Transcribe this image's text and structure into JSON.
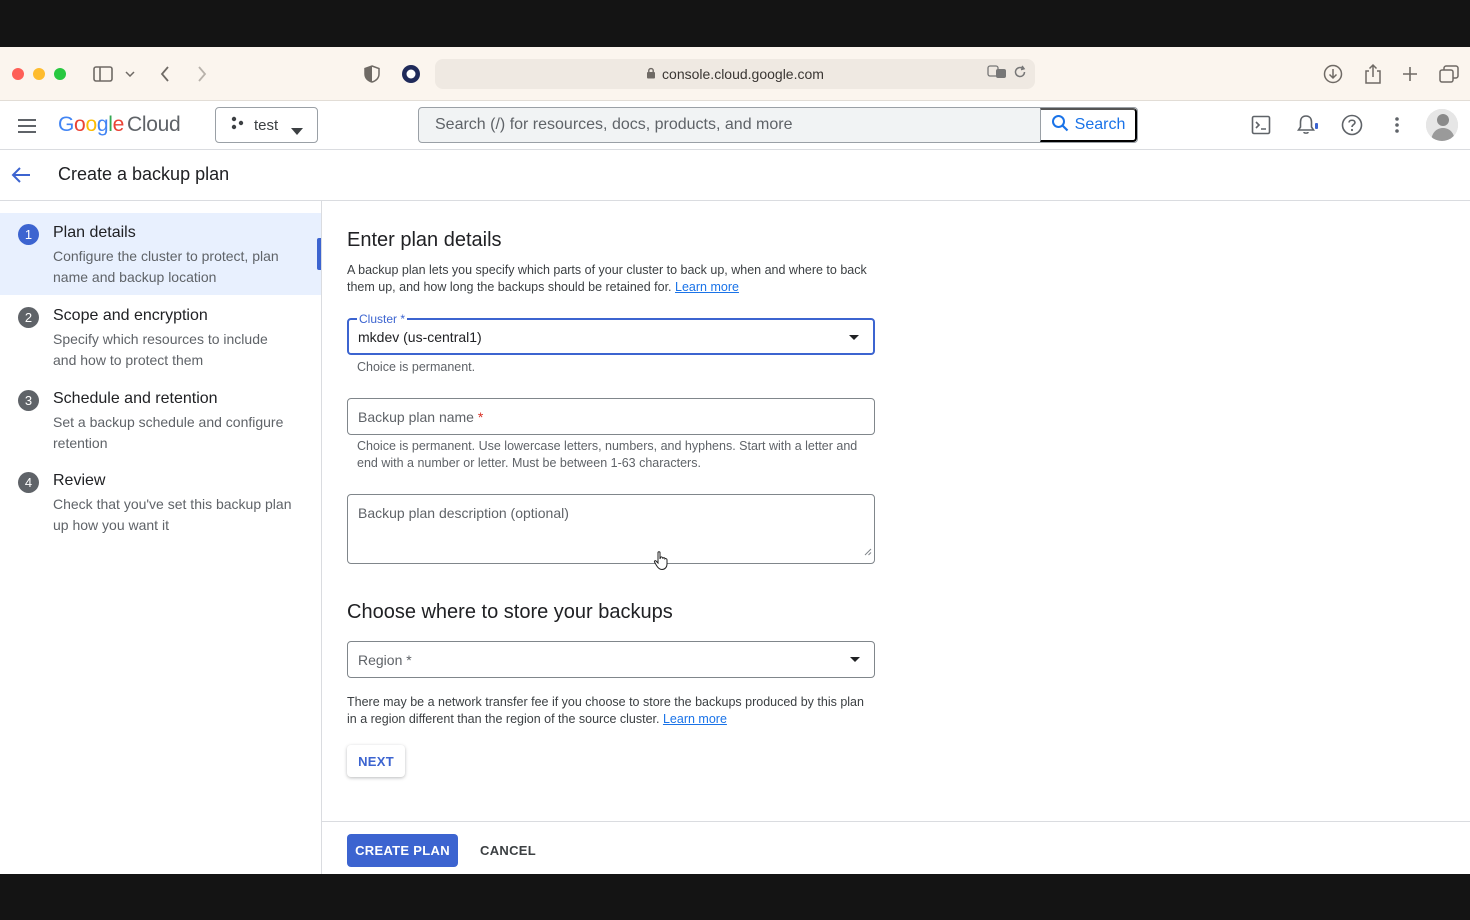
{
  "browser": {
    "url": "console.cloud.google.com"
  },
  "header": {
    "logo": {
      "g1": "G",
      "g2": "o",
      "g3": "o",
      "g4": "g",
      "g5": "l",
      "g6": "e",
      "cloud": "Cloud"
    },
    "project": "test",
    "search_placeholder": "Search (/) for resources, docs, products, and more",
    "search_button": "Search"
  },
  "page": {
    "title": "Create a backup plan"
  },
  "stepper": {
    "steps": [
      {
        "num": "1",
        "title": "Plan details",
        "desc": "Configure the cluster to protect, plan name and backup location"
      },
      {
        "num": "2",
        "title": "Scope and encryption",
        "desc": "Specify which resources to include and how to protect them"
      },
      {
        "num": "3",
        "title": "Schedule and retention",
        "desc": "Set a backup schedule and configure retention"
      },
      {
        "num": "4",
        "title": "Review",
        "desc": "Check that you've set this backup plan up how you want it"
      }
    ]
  },
  "form": {
    "heading": "Enter plan details",
    "intro": "A backup plan lets you specify which parts of your cluster to back up, when and where to back them up, and how long the backups should be retained for.",
    "learn_more": "Learn more",
    "cluster": {
      "label": "Cluster",
      "required_mark": "*",
      "value": "mkdev (us-central1)",
      "hint": "Choice is permanent."
    },
    "plan_name": {
      "label": "Backup plan name",
      "required_mark": "*",
      "hint": "Choice is permanent. Use lowercase letters, numbers, and hyphens. Start with a letter and end with a number or letter. Must be between 1-63 characters."
    },
    "description": {
      "label": "Backup plan description (optional)"
    },
    "storage_heading": "Choose where to store your backups",
    "region": {
      "label": "Region",
      "required_mark": "*"
    },
    "transfer_note": "There may be a network transfer fee if you choose to store the backups produced by this plan in a region different than the region of the source cluster.",
    "learn_more_2": "Learn more",
    "next": "NEXT"
  },
  "footer": {
    "create": "CREATE PLAN",
    "cancel": "CANCEL"
  }
}
